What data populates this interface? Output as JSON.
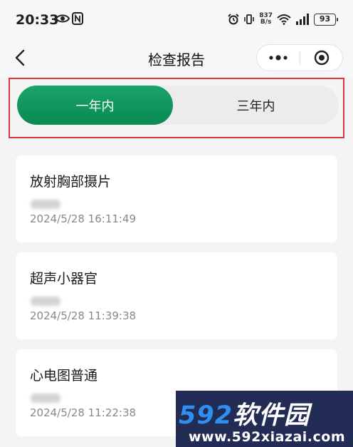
{
  "status_bar": {
    "time": "20:33",
    "net_speed_value": "837",
    "net_speed_unit": "B/s",
    "battery": "93"
  },
  "nav": {
    "title": "检查报告"
  },
  "tabs": [
    {
      "label": "一年内",
      "active": true
    },
    {
      "label": "三年内",
      "active": false
    }
  ],
  "reports": [
    {
      "name": "放射胸部摄片",
      "date": "2024/5/28 16:11:49"
    },
    {
      "name": "超声小器官",
      "date": "2024/5/28 11:39:38"
    },
    {
      "name": "心电图普通",
      "date": "2024/5/28 11:22:38"
    }
  ],
  "watermark": {
    "logo_number": "592",
    "logo_text": "软件园",
    "url": "www.592xiazai.com"
  },
  "colors": {
    "accent_green": "#0f9a5e",
    "highlight_border": "#d9383b",
    "watermark_bg": "#232c55",
    "watermark_blue": "#2f8ff0"
  }
}
